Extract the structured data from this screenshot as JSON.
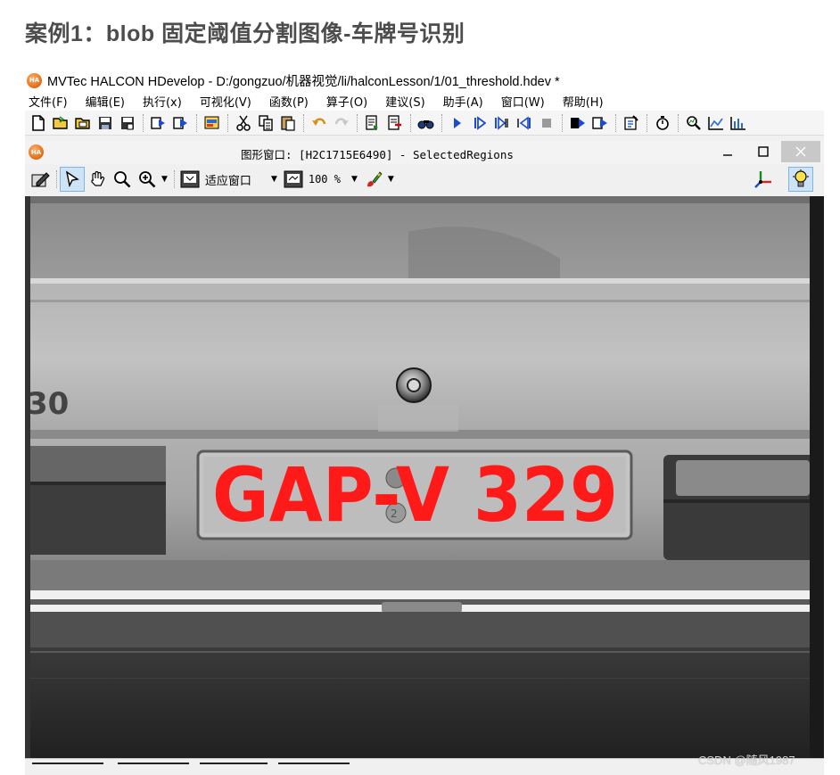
{
  "article": {
    "title": "案例1：blob 固定阈值分割图像-车牌号识别"
  },
  "app": {
    "logo_text": "HA",
    "title": "MVTec HALCON HDevelop - D:/gongzuo/机器视觉/li/halconLesson/1/01_threshold.hdev *"
  },
  "menu": [
    {
      "label": "文件(F)"
    },
    {
      "label": "编辑(E)"
    },
    {
      "label": "执行(x)"
    },
    {
      "label": "可视化(V)"
    },
    {
      "label": "函数(P)"
    },
    {
      "label": "算子(O)"
    },
    {
      "label": "建议(S)"
    },
    {
      "label": "助手(A)"
    },
    {
      "label": "窗口(W)"
    },
    {
      "label": "帮助(H)"
    }
  ],
  "graphics_window": {
    "title": "图形窗口: [H2C1715E6490] - SelectedRegions",
    "fit_label": "适应窗口",
    "zoom_label": "100 %"
  },
  "image": {
    "plate_text": "GAP-V 329",
    "badge_text": "30",
    "region_color": "#ff1a1a"
  },
  "watermark": "CSDN @随风1987"
}
